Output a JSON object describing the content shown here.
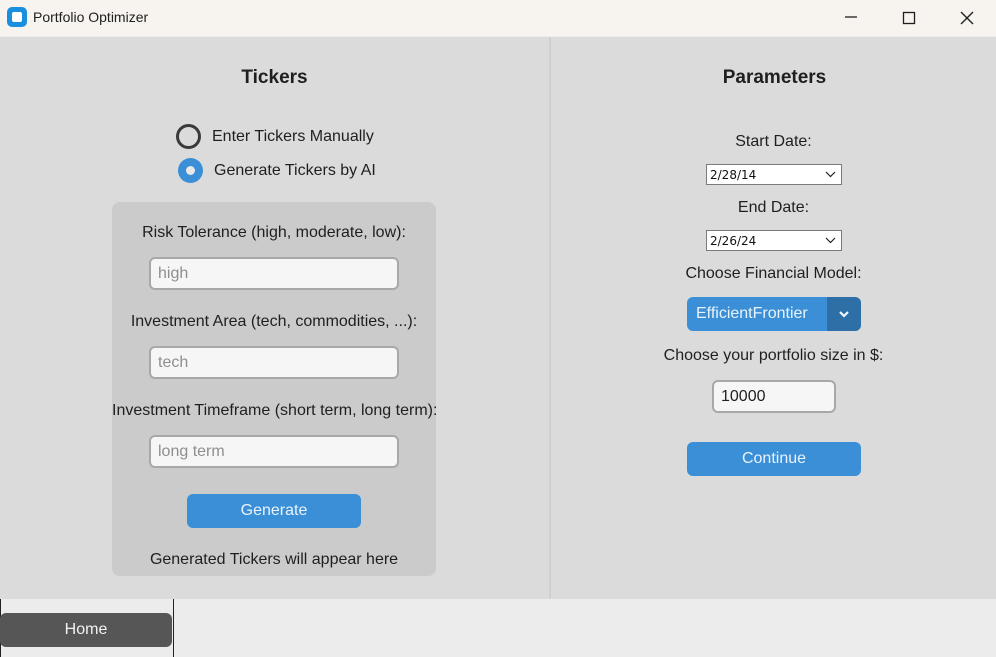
{
  "window": {
    "title": "Portfolio Optimizer",
    "icon": "app-icon",
    "controls": [
      "minimize-icon",
      "maximize-icon",
      "close-icon"
    ]
  },
  "tickers": {
    "heading": "Tickers",
    "radio_manual": {
      "label": "Enter Tickers Manually",
      "selected": false
    },
    "radio_ai": {
      "label": "Generate Tickers by AI",
      "selected": true
    },
    "risk_label": "Risk Tolerance (high, moderate, low):",
    "risk_placeholder": "high",
    "area_label": "Investment Area (tech, commodities, ...):",
    "area_placeholder": "tech",
    "timeframe_label": "Investment Timeframe (short term, long term):",
    "timeframe_placeholder": "long term",
    "generate_button": "Generate",
    "generated_text": "Generated Tickers will appear here"
  },
  "parameters": {
    "heading": "Parameters",
    "start_label": "Start Date:",
    "start_value": "2/28/14",
    "end_label": "End Date:",
    "end_value": "2/26/24",
    "model_label": "Choose Financial Model:",
    "model_value": "EfficientFrontier",
    "size_label": "Choose your portfolio size in $:",
    "size_value": "10000",
    "continue_button": "Continue"
  },
  "footer": {
    "home_button": "Home"
  },
  "colors": {
    "accent": "#3a8fd6",
    "accent_dark": "#2f6fa8",
    "panel": "#dbdbdb",
    "inner_panel": "#cbcbcb",
    "home_button": "#565656"
  }
}
